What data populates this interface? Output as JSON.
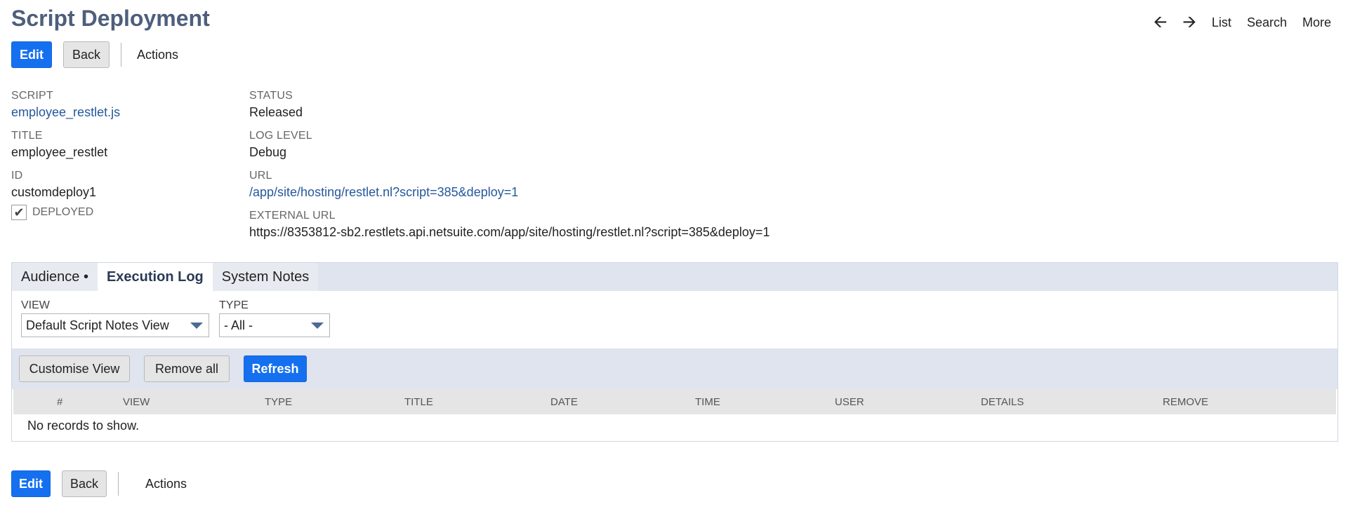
{
  "page": {
    "title": "Script Deployment"
  },
  "nav": {
    "list": "List",
    "search": "Search",
    "more": "More"
  },
  "toolbar": {
    "edit": "Edit",
    "back": "Back",
    "actions": "Actions"
  },
  "fields": {
    "script": {
      "label": "SCRIPT",
      "value": "employee_restlet.js"
    },
    "title": {
      "label": "TITLE",
      "value": "employee_restlet"
    },
    "id": {
      "label": "ID",
      "value": "customdeploy1"
    },
    "deployed": {
      "label": "DEPLOYED",
      "checked": true
    },
    "status": {
      "label": "STATUS",
      "value": "Released"
    },
    "log_level": {
      "label": "LOG LEVEL",
      "value": "Debug"
    },
    "url": {
      "label": "URL",
      "value": "/app/site/hosting/restlet.nl?script=385&deploy=1"
    },
    "external_url": {
      "label": "EXTERNAL URL",
      "value": "https://8353812-sb2.restlets.api.netsuite.com/app/site/hosting/restlet.nl?script=385&deploy=1"
    }
  },
  "tabs": {
    "audience": "Audience •",
    "execution_log": "Execution Log",
    "system_notes": "System Notes"
  },
  "filters": {
    "view_label": "VIEW",
    "view_value": "Default Script Notes View",
    "type_label": "TYPE",
    "type_value": "- All -"
  },
  "list_buttons": {
    "customise": "Customise View",
    "remove_all": "Remove all",
    "refresh": "Refresh"
  },
  "columns": [
    "#",
    "VIEW",
    "TYPE",
    "TITLE",
    "DATE",
    "TIME",
    "USER",
    "DETAILS",
    "REMOVE"
  ],
  "empty_message": "No records to show.",
  "colors": {
    "title": "#4d5f7c",
    "primary": "#1570ef",
    "link": "#24589c",
    "tab_bar": "#dfe4ee"
  }
}
